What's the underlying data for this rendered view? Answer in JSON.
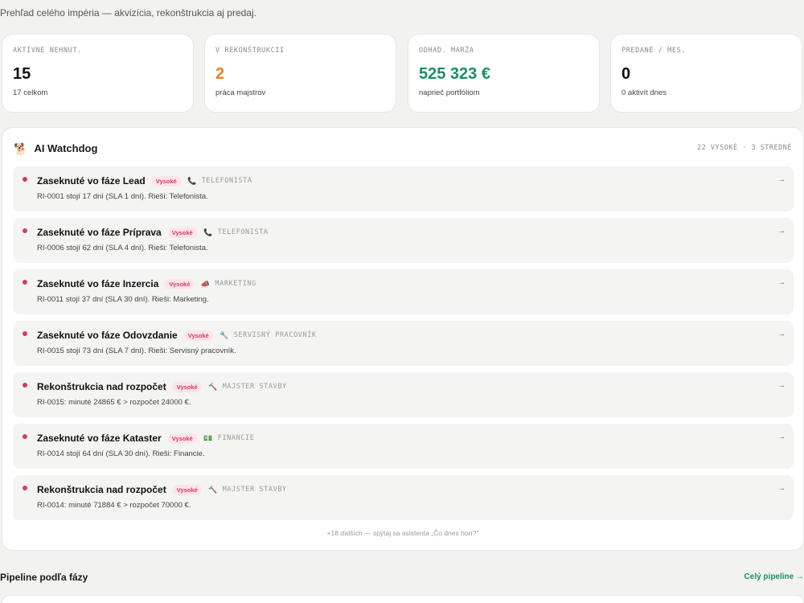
{
  "header": {
    "subtitle": "Prehľad celého impéria — akvizícia, rekonštrukcia aj predaj."
  },
  "stats": [
    {
      "label": "AKTÍVNE NEHNUT.",
      "value": "15",
      "sub": "17 celkom",
      "color": "#111111"
    },
    {
      "label": "V REKONŠTRUKCII",
      "value": "2",
      "sub": "práca majstrov",
      "color": "#ef7d22"
    },
    {
      "label": "ODHAD. MARŽA",
      "value": "525 323 €",
      "sub": "naprieč portfóliom",
      "color": "#1a8f63"
    },
    {
      "label": "PREDANÉ / MES.",
      "value": "0",
      "sub": "0 aktivít dnes",
      "color": "#111111"
    }
  ],
  "watchdog": {
    "icon": "dog-icon",
    "title": "AI Watchdog",
    "counts": "22 VYSOKÉ · 3 STREDNÉ",
    "alerts": [
      {
        "title": "Zaseknuté vo fáze Lead",
        "badge": "Vysoké",
        "role_icon": "phone-icon",
        "role_glyph": "📞",
        "role": "TELEFONISTA",
        "detail": "RI-0001 stojí 17 dní (SLA 1 dní). Rieši: Telefonista.",
        "arrow": "→"
      },
      {
        "title": "Zaseknuté vo fáze Príprava",
        "badge": "Vysoké",
        "role_icon": "phone-icon",
        "role_glyph": "📞",
        "role": "TELEFONISTA",
        "detail": "RI-0006 stojí 62 dní (SLA 4 dní). Rieši: Telefonista.",
        "arrow": "→"
      },
      {
        "title": "Zaseknuté vo fáze Inzercia",
        "badge": "Vysoké",
        "role_icon": "megaphone-icon",
        "role_glyph": "📣",
        "role": "MARKETING",
        "detail": "RI-0011 stojí 37 dní (SLA 30 dní). Rieši: Marketing.",
        "arrow": "→"
      },
      {
        "title": "Zaseknuté vo fáze Odovzdanie",
        "badge": "Vysoké",
        "role_icon": "wrench-icon",
        "role_glyph": "🔧",
        "role": "SERVISNÝ PRACOVNÍK",
        "detail": "RI-0015 stojí 73 dní (SLA 7 dní). Rieši: Servisný pracovník.",
        "arrow": "→"
      },
      {
        "title": "Rekonštrukcia nad rozpočet",
        "badge": "Vysoké",
        "role_icon": "hammer-icon",
        "role_glyph": "🔨",
        "role": "MAJSTER STAVBY",
        "detail": "RI-0015: minuté 24865 € > rozpočet 24000 €.",
        "arrow": "→"
      },
      {
        "title": "Zaseknuté vo fáze Kataster",
        "badge": "Vysoké",
        "role_icon": "money-icon",
        "role_glyph": "💵",
        "role": "FINANCIE",
        "detail": "RI-0014 stojí 64 dní (SLA 30 dní). Rieši: Financie.",
        "arrow": "→"
      },
      {
        "title": "Rekonštrukcia nad rozpočet",
        "badge": "Vysoké",
        "role_icon": "hammer-icon",
        "role_glyph": "🔨",
        "role": "MAJSTER STAVBY",
        "detail": "RI-0014: minuté 71884 € > rozpočet 70000 €.",
        "arrow": "→"
      }
    ],
    "more": "+18 ďalších — spýtaj sa asistenta „Čo dnes horí?\""
  },
  "pipeline": {
    "title": "Pipeline podľa fázy",
    "link": "Celý pipeline →"
  }
}
